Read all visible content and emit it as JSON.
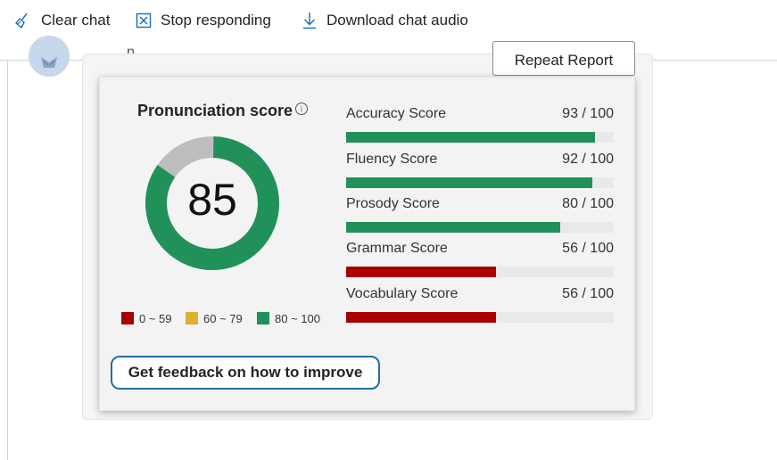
{
  "toolbar": {
    "clear_chat_label": "Clear chat",
    "stop_responding_label": "Stop responding",
    "download_audio_label": "Download chat audio",
    "icon_color": "#0f6cbd"
  },
  "message": {
    "fragment": "p",
    "repeat_report_label": "Repeat Report"
  },
  "pronunciation": {
    "title": "Pronunciation score",
    "info_icon": "info-icon",
    "score": "85",
    "score_value": 85,
    "legend": [
      {
        "label": "0 ~ 59",
        "color": "#a80000"
      },
      {
        "label": "60 ~ 79",
        "color": "#d8b232"
      },
      {
        "label": "80 ~ 100",
        "color": "#21915a"
      }
    ],
    "scores": [
      {
        "name": "Accuracy Score",
        "display": "93 / 100",
        "value": 93,
        "color": "#21915a"
      },
      {
        "name": "Fluency Score",
        "display": "92 / 100",
        "value": 92,
        "color": "#21915a"
      },
      {
        "name": "Prosody Score",
        "display": "80 / 100",
        "value": 80,
        "color": "#21915a"
      },
      {
        "name": "Grammar Score",
        "display": "56 / 100",
        "value": 56,
        "color": "#a80000"
      },
      {
        "name": "Vocabulary Score",
        "display": "56 / 100",
        "value": 56,
        "color": "#a80000"
      }
    ],
    "feedback_button_label": "Get feedback on how to improve",
    "colors": {
      "good": "#21915a",
      "remainder": "#bdbdbd",
      "track": "#e9e9e9"
    }
  }
}
